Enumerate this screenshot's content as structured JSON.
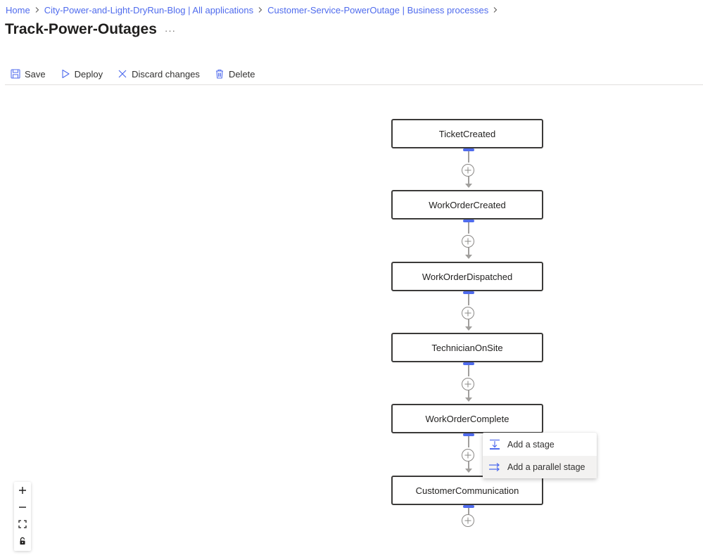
{
  "breadcrumb": [
    {
      "label": "Home"
    },
    {
      "label": "City-Power-and-Light-DryRun-Blog | All applications"
    },
    {
      "label": "Customer-Service-PowerOutage | Business processes"
    }
  ],
  "page_title": "Track-Power-Outages",
  "more_label": "···",
  "toolbar": {
    "save_label": "Save",
    "deploy_label": "Deploy",
    "discard_label": "Discard changes",
    "delete_label": "Delete"
  },
  "stages": [
    {
      "label": "TicketCreated"
    },
    {
      "label": "WorkOrderCreated"
    },
    {
      "label": "WorkOrderDispatched"
    },
    {
      "label": "TechnicianOnSite"
    },
    {
      "label": "WorkOrderComplete"
    },
    {
      "label": "CustomerCommunication"
    }
  ],
  "context_menu": {
    "add_stage_label": "Add a stage",
    "add_parallel_stage_label": "Add a parallel stage"
  },
  "colors": {
    "accent": "#4f6bed",
    "stage_border": "#3b3a39",
    "connector": "#a19f9d"
  },
  "icons": {
    "save": "save-icon",
    "deploy": "play-icon",
    "discard": "close-icon",
    "delete": "trash-icon",
    "add_stage": "add-stage-icon",
    "add_parallel": "parallel-stage-icon",
    "zoom_in": "zoom-in-icon",
    "zoom_out": "zoom-out-icon",
    "fit": "fit-view-icon",
    "lock": "lock-icon"
  }
}
